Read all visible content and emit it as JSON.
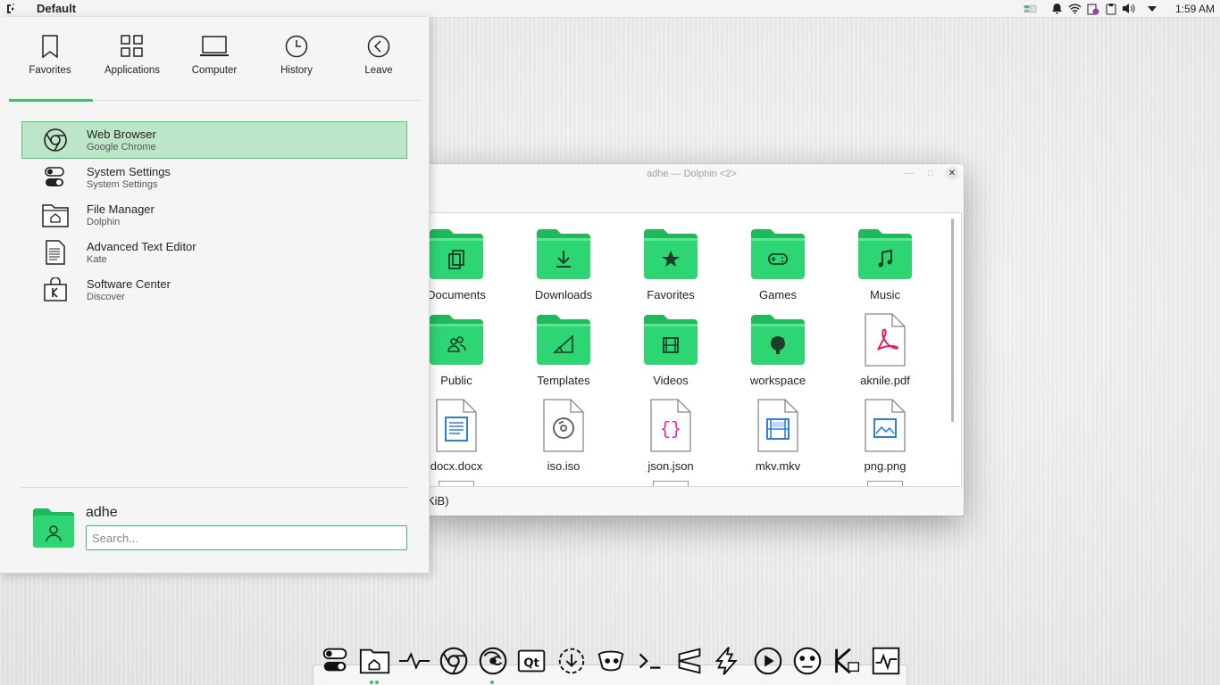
{
  "top_panel": {
    "activity": "Default",
    "clock": "1:59 AM",
    "tray_icons": [
      "vpn-icon",
      "notification-bell-icon",
      "wifi-icon",
      "device-notifier-icon",
      "clipboard-icon",
      "volume-icon",
      "expand-tray-icon"
    ]
  },
  "launcher": {
    "tabs": [
      {
        "label": "Favorites",
        "icon": "bookmark-icon",
        "active": true
      },
      {
        "label": "Applications",
        "icon": "applications-grid-icon",
        "active": false
      },
      {
        "label": "Computer",
        "icon": "computer-icon",
        "active": false
      },
      {
        "label": "History",
        "icon": "clock-icon",
        "active": false
      },
      {
        "label": "Leave",
        "icon": "leave-icon",
        "active": false
      }
    ],
    "favorites": [
      {
        "name": "Web Browser",
        "sub": "Google Chrome",
        "icon": "chrome-icon",
        "selected": true
      },
      {
        "name": "System Settings",
        "sub": "System Settings",
        "icon": "settings-toggle-icon",
        "selected": false
      },
      {
        "name": "File Manager",
        "sub": "Dolphin",
        "icon": "folder-home-icon",
        "selected": false
      },
      {
        "name": "Advanced Text Editor",
        "sub": "Kate",
        "icon": "text-editor-icon",
        "selected": false
      },
      {
        "name": "Software Center",
        "sub": "Discover",
        "icon": "software-center-icon",
        "selected": false
      }
    ],
    "user": {
      "name": "adhe"
    },
    "search": {
      "placeholder": "Search...",
      "value": ""
    }
  },
  "dolphin": {
    "title": "adhe — Dolphin <2>",
    "status": "KiB)",
    "files": [
      {
        "name": "Documents",
        "kind": "folder",
        "glyph": "documents"
      },
      {
        "name": "Downloads",
        "kind": "folder",
        "glyph": "downloads"
      },
      {
        "name": "Favorites",
        "kind": "folder",
        "glyph": "star"
      },
      {
        "name": "Games",
        "kind": "folder",
        "glyph": "gamepad"
      },
      {
        "name": "Music",
        "kind": "folder",
        "glyph": "music"
      },
      {
        "name": "Public",
        "kind": "folder",
        "glyph": "people"
      },
      {
        "name": "Templates",
        "kind": "folder",
        "glyph": "templates"
      },
      {
        "name": "Videos",
        "kind": "folder",
        "glyph": "film"
      },
      {
        "name": "workspace",
        "kind": "folder",
        "glyph": "github"
      },
      {
        "name": "aknile.pdf",
        "kind": "file",
        "glyph": "pdf"
      },
      {
        "name": "docx.docx",
        "kind": "file",
        "glyph": "docx"
      },
      {
        "name": "iso.iso",
        "kind": "file",
        "glyph": "iso"
      },
      {
        "name": "json.json",
        "kind": "file",
        "glyph": "json"
      },
      {
        "name": "mkv.mkv",
        "kind": "file",
        "glyph": "mkv"
      },
      {
        "name": "png.png",
        "kind": "file",
        "glyph": "png"
      }
    ]
  },
  "dock": {
    "apps": [
      "system-settings-icon",
      "file-manager-icon",
      "system-monitor-icon",
      "chrome-icon",
      "firefox-icon",
      "qt-creator-icon",
      "software-update-icon",
      "gimp-icon",
      "terminal-icon",
      "sublime-text-icon",
      "inkscape-icon",
      "media-player-icon",
      "game-icon",
      "kdenlive-icon",
      "ksysguard-icon"
    ],
    "colors": {
      "accent": "#3fbf6b",
      "folder": "#2ed573"
    }
  }
}
